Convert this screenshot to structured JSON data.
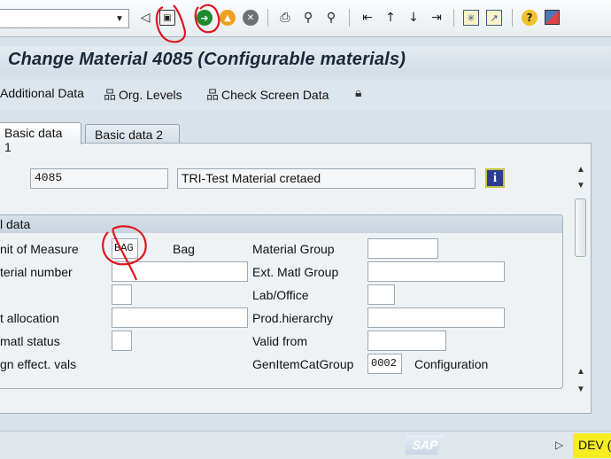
{
  "toolbar": {
    "command_field_value": "",
    "icons": [
      "back-icon",
      "save-icon",
      "green-back-icon",
      "exit-icon",
      "cancel-icon",
      "print-icon",
      "find-icon",
      "find-next-icon",
      "first-page-icon",
      "previous-page-icon",
      "next-page-icon",
      "last-page-icon",
      "create-session-icon",
      "shortcut-icon",
      "help-icon",
      "layout-menu-icon"
    ]
  },
  "title": "Change Material 4085 (Configurable materials)",
  "app_toolbar": {
    "additional_data": "Additional Data",
    "org_levels": "Org. Levels",
    "check_screen_data": "Check Screen Data"
  },
  "tabs": [
    {
      "label": "Basic data 1",
      "active": true
    },
    {
      "label": "Basic data 2",
      "active": false
    }
  ],
  "material": {
    "number": "4085",
    "description": "TRI-Test Material cretaed"
  },
  "general_data": {
    "title": "l data",
    "left_fields": [
      {
        "label": "nit of Measure",
        "value": "BAG",
        "text": "Bag"
      },
      {
        "label": "terial number",
        "value": ""
      },
      {
        "label": "",
        "value": ""
      },
      {
        "label": "t allocation",
        "value": ""
      },
      {
        "label": " matl status",
        "value": ""
      },
      {
        "label": "gn effect. vals"
      }
    ],
    "right_fields": [
      {
        "label": "Material Group",
        "value": ""
      },
      {
        "label": "Ext. Matl Group",
        "value": ""
      },
      {
        "label": "Lab/Office",
        "value": ""
      },
      {
        "label": "Prod.hierarchy",
        "value": ""
      },
      {
        "label": "Valid from",
        "value": ""
      },
      {
        "label": "GenItemCatGroup",
        "value": "0002",
        "text": "Configuration"
      }
    ]
  },
  "status": {
    "logo": "SAP",
    "system": "DEV ("
  },
  "colors": {
    "annotation": "#e0161d",
    "status_highlight": "#f5ee22",
    "info_button": "#2b3c96"
  }
}
